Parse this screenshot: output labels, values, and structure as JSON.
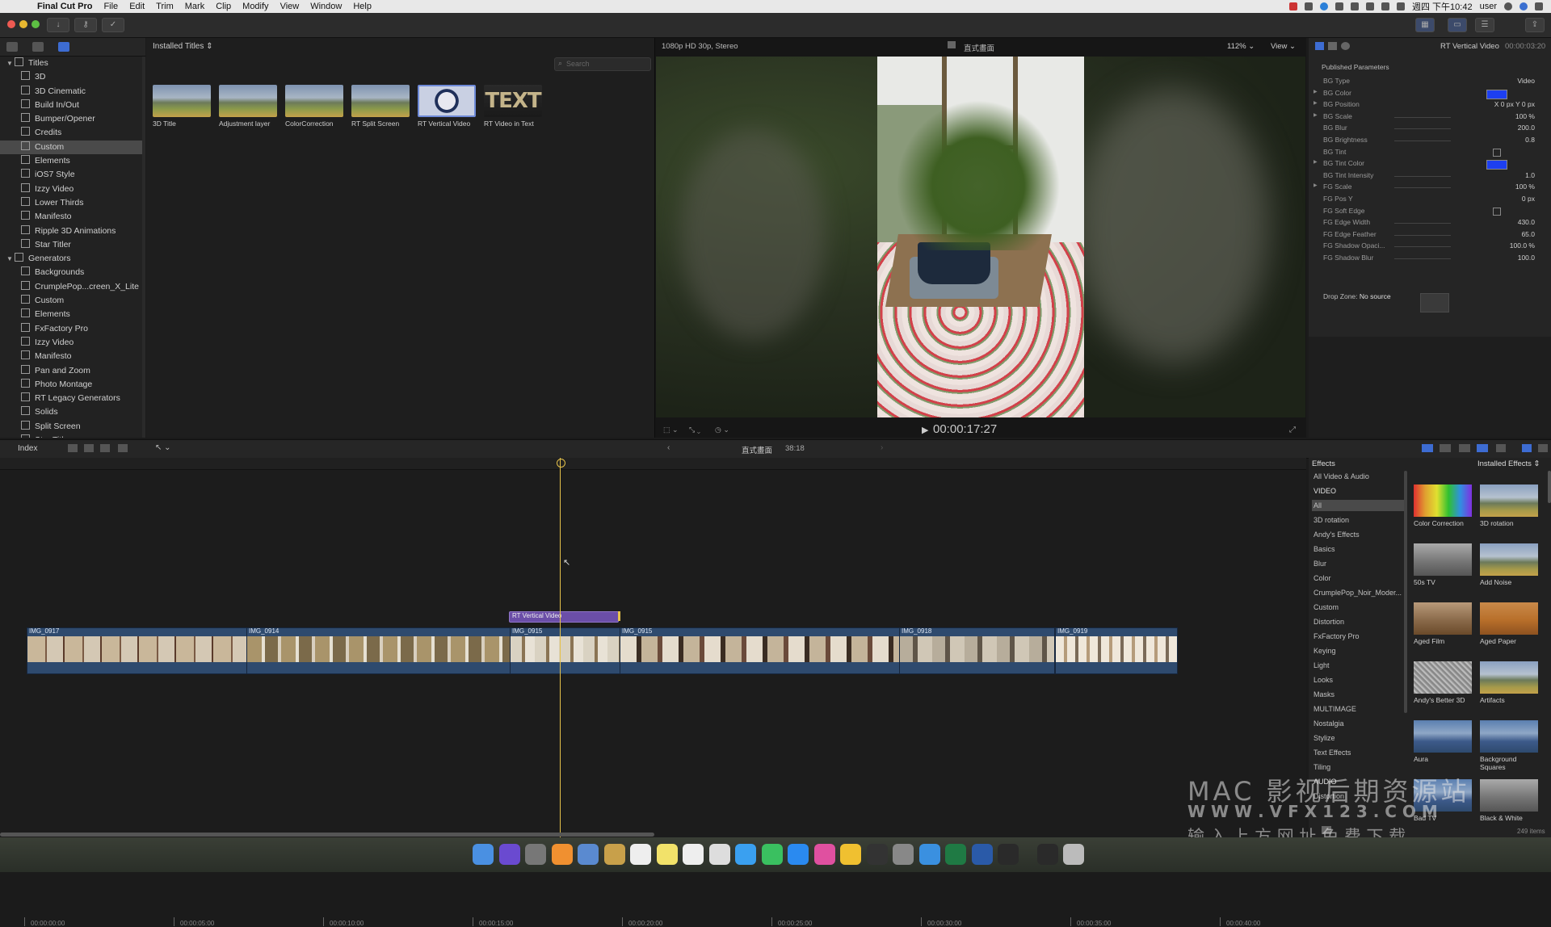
{
  "menubar": {
    "app": "Final Cut Pro",
    "items": [
      "File",
      "Edit",
      "Trim",
      "Mark",
      "Clip",
      "Modify",
      "View",
      "Window",
      "Help"
    ],
    "clock": "週四 下午10:42",
    "user": "user"
  },
  "browser": {
    "installed_label": "Installed Titles",
    "search_placeholder": "Search",
    "thumbs": [
      {
        "label": "3D Title",
        "kind": "mountain"
      },
      {
        "label": "Adjustment layer",
        "kind": "mountain"
      },
      {
        "label": "ColorCorrection",
        "kind": "mountain"
      },
      {
        "label": "RT Split Screen",
        "kind": "mountain"
      },
      {
        "label": "RT Vertical Video",
        "kind": "logo"
      },
      {
        "label": "RT Video in Text",
        "kind": "text"
      }
    ]
  },
  "sidebar": {
    "titles_group": "Titles",
    "titles": [
      "3D",
      "3D Cinematic",
      "Build In/Out",
      "Bumper/Opener",
      "Credits",
      "Custom",
      "Elements",
      "iOS7 Style",
      "Izzy Video",
      "Lower Thirds",
      "Manifesto",
      "Ripple 3D Animations",
      "Star Titler"
    ],
    "selected": "Custom",
    "generators_group": "Generators",
    "generators": [
      "Backgrounds",
      "CrumplePop...creen_X_Lite",
      "Custom",
      "Elements",
      "FxFactory Pro",
      "Izzy Video",
      "Manifesto",
      "Pan and Zoom",
      "Photo Montage",
      "RT Legacy Generators",
      "Solids",
      "Split Screen",
      "Star Titler"
    ]
  },
  "viewer": {
    "format": "1080p HD 30p, Stereo",
    "project": "直式畫面",
    "zoom": "112%",
    "view_label": "View",
    "timecode": "00:00:17:27"
  },
  "inspector": {
    "title": "RT Vertical Video",
    "duration": "00:00:03:20",
    "section": "Published Parameters",
    "params": [
      {
        "name": "BG Type",
        "value": "Video"
      },
      {
        "name": "BG Color",
        "value": ""
      },
      {
        "name": "BG Position",
        "value": "X   0 px   Y   0 px"
      },
      {
        "name": "BG Scale",
        "value": "100 %"
      },
      {
        "name": "BG Blur",
        "value": "200.0"
      },
      {
        "name": "BG Brightness",
        "value": "0.8"
      },
      {
        "name": "BG Tint",
        "value": ""
      },
      {
        "name": "BG Tint Color",
        "value": ""
      },
      {
        "name": "BG Tint Intensity",
        "value": "1.0"
      },
      {
        "name": "FG Scale",
        "value": "100 %"
      },
      {
        "name": "FG Pos Y",
        "value": "0 px"
      },
      {
        "name": "FG Soft Edge",
        "value": ""
      },
      {
        "name": "FG Edge Width",
        "value": "430.0"
      },
      {
        "name": "FG Edge Feather",
        "value": "65.0"
      },
      {
        "name": "FG Shadow Opaci...",
        "value": "100.0 %"
      },
      {
        "name": "FG Shadow Blur",
        "value": "100.0"
      }
    ],
    "drop_zone_label": "Drop Zone:",
    "drop_zone_value": "No source",
    "bg_color_hex": "#1d3ff0"
  },
  "timeline": {
    "index_label": "Index",
    "project": "直式畫面",
    "duration": "38:18",
    "ruler": [
      "00:00:00:00",
      "00:00:05:00",
      "00:00:10:00",
      "00:00:15:00",
      "00:00:20:00",
      "00:00:25:00",
      "00:00:30:00",
      "00:00:35:00",
      "00:00:40:00"
    ],
    "title_clip": "RT Vertical Video",
    "clips": [
      "IMG_0917",
      "IMG_0914",
      "IMG_0915",
      "IMG_0915",
      "IMG_0918",
      "IMG_0919"
    ]
  },
  "effects": {
    "header": "Effects",
    "installed_label": "Installed Effects",
    "categories": [
      "All Video & Audio",
      "VIDEO",
      "All",
      "3D rotation",
      "Andy's Effects",
      "Basics",
      "Blur",
      "Color",
      "CrumplePop_Noir_Moder...",
      "Custom",
      "Distortion",
      "FxFactory Pro",
      "Keying",
      "Light",
      "Looks",
      "Masks",
      "MULTIMAGE",
      "Nostalgia",
      "Stylize",
      "Text Effects",
      "Tiling",
      "AUDIO",
      "Distortion"
    ],
    "selected": "All",
    "thumbs": [
      {
        "label": "Color Correction",
        "kind": "rainbow"
      },
      {
        "label": "3D rotation",
        "kind": "mountain"
      },
      {
        "label": "50s TV",
        "kind": "gray"
      },
      {
        "label": "Add Noise",
        "kind": "mountain"
      },
      {
        "label": "Aged Film",
        "kind": "sepia"
      },
      {
        "label": "Aged Paper",
        "kind": "paper"
      },
      {
        "label": "Andy's Better 3D",
        "kind": "noise"
      },
      {
        "label": "Artifacts",
        "kind": "mountain"
      },
      {
        "label": "Aura",
        "kind": "blue"
      },
      {
        "label": "Background Squares",
        "kind": "blue"
      },
      {
        "label": "Bad TV",
        "kind": "blue"
      },
      {
        "label": "Black & White",
        "kind": "gray"
      }
    ],
    "count": "249 items"
  },
  "watermark": {
    "line1": "MAC 影视后期资源站",
    "line2": "W W W . V F X 1 2 3 . C O M",
    "line3": "输 入 上 方 网 址   免 费 下 载"
  },
  "colors": {
    "accent": "#4a7ee8",
    "clip": "#2e4a6e",
    "title_clip": "#6b4ea8",
    "playhead": "#e6c24a"
  }
}
